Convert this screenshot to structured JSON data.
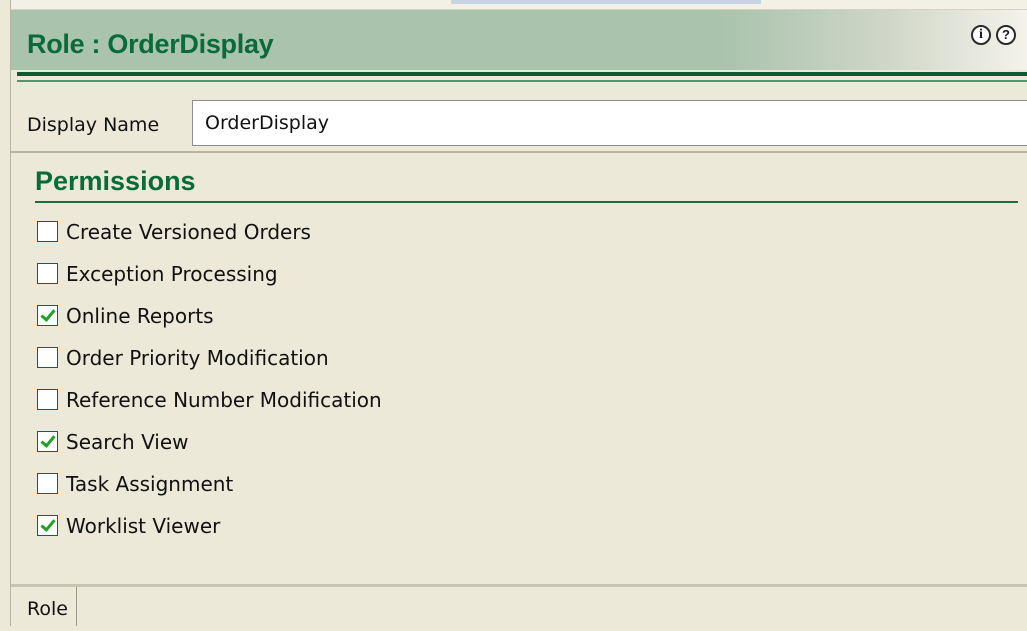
{
  "header": {
    "title": "Role : OrderDisplay",
    "icons": [
      "info-icon",
      "help-icon"
    ]
  },
  "display_name": {
    "label": "Display Name",
    "value": "OrderDisplay"
  },
  "permissions": {
    "title": "Permissions",
    "items": [
      {
        "label": "Create Versioned Orders",
        "checked": false
      },
      {
        "label": "Exception Processing",
        "checked": false
      },
      {
        "label": "Online Reports",
        "checked": true
      },
      {
        "label": "Order Priority Modification",
        "checked": false
      },
      {
        "label": "Reference Number Modification",
        "checked": false
      },
      {
        "label": "Search View",
        "checked": true
      },
      {
        "label": "Task Assignment",
        "checked": false
      },
      {
        "label": "Worklist Viewer",
        "checked": true
      }
    ]
  },
  "tabs": [
    {
      "label": "Role"
    }
  ],
  "colors": {
    "title_green": "#0a6b3a",
    "header_bg": "#a9c3ad",
    "panel_bg": "#ece9d8",
    "check_green": "#21a121"
  }
}
